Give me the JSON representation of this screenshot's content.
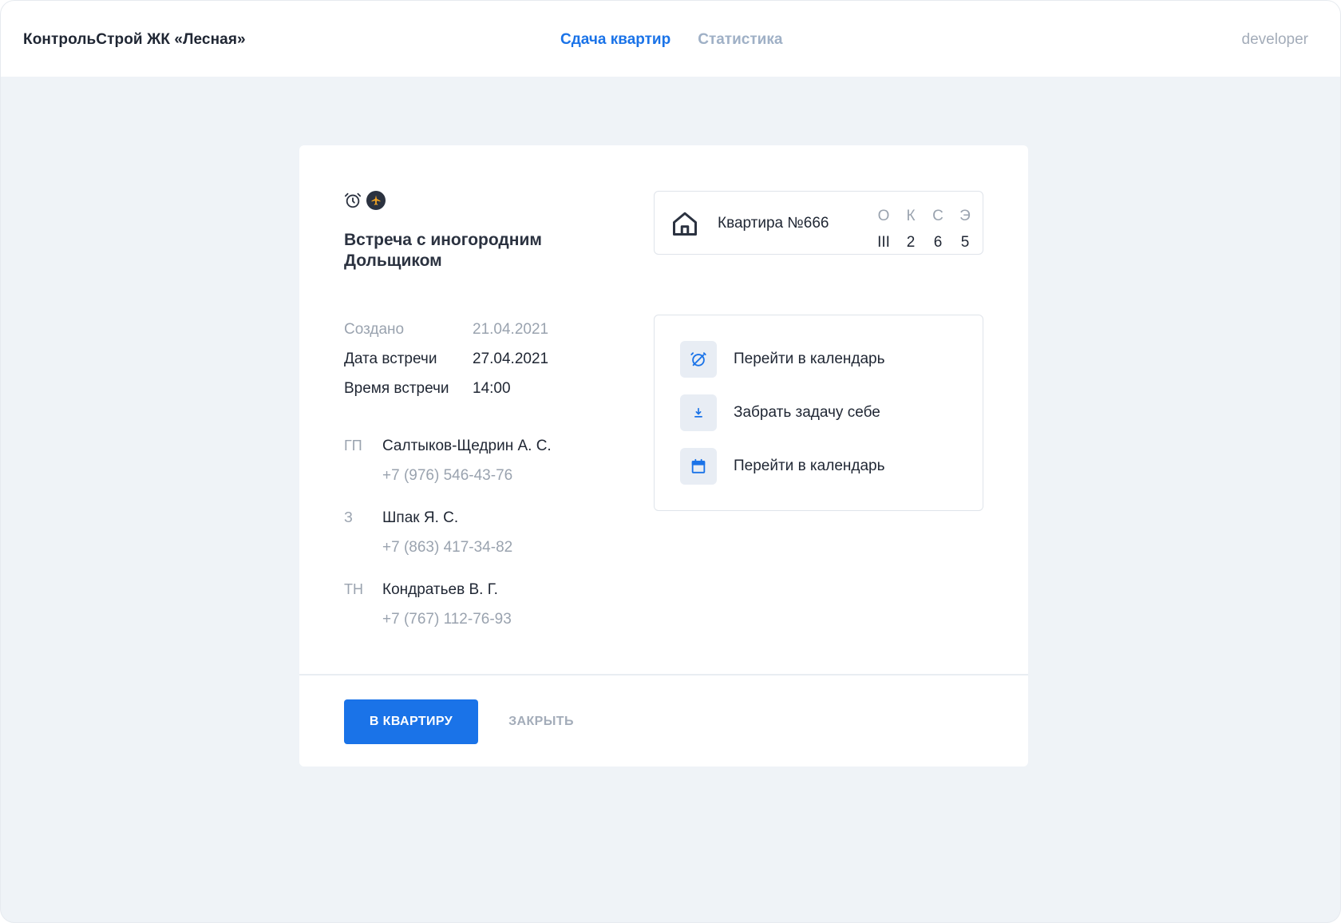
{
  "header": {
    "brand": "КонтрольСтрой ЖК «Лесная»",
    "nav": [
      {
        "label": "Сдача квартир",
        "active": true
      },
      {
        "label": "Статистика",
        "active": false
      }
    ],
    "user": "developer"
  },
  "task": {
    "status_icons": [
      "alarm-clock-icon",
      "airplane-icon"
    ],
    "title": "Встреча с иногородним Дольщиком",
    "meta": [
      {
        "label": "Создано",
        "value": "21.04.2021"
      },
      {
        "label": "Дата встречи",
        "value": "27.04.2021"
      },
      {
        "label": "Время встречи",
        "value": "14:00"
      }
    ],
    "contacts": [
      {
        "role": "ГП",
        "name": "Салтыков-Щедрин А. С.",
        "phone": "+7 (976) 546-43-76"
      },
      {
        "role": "З",
        "name": "Шпак Я. С.",
        "phone": "+7 (863) 417-34-82"
      },
      {
        "role": "ТН",
        "name": "Кондратьев В. Г.",
        "phone": "+7 (767) 112-76-93"
      }
    ]
  },
  "apartment": {
    "title": "Квартира №666",
    "headers": [
      "О",
      "К",
      "С",
      "Э"
    ],
    "values": [
      "III",
      "2",
      "6",
      "5"
    ]
  },
  "actions": [
    {
      "label": "Перейти в календарь",
      "icon": "alarm-off-icon"
    },
    {
      "label": "Забрать задачу себе",
      "icon": "download-icon"
    },
    {
      "label": "Перейти в календарь",
      "icon": "calendar-icon"
    }
  ],
  "buttons": {
    "primary": "В КВАРТИРУ",
    "secondary": "ЗАКРЫТЬ"
  },
  "colors": {
    "accent": "#1a73e8",
    "background": "#eff3f7",
    "muted_text": "#9aa3af"
  }
}
